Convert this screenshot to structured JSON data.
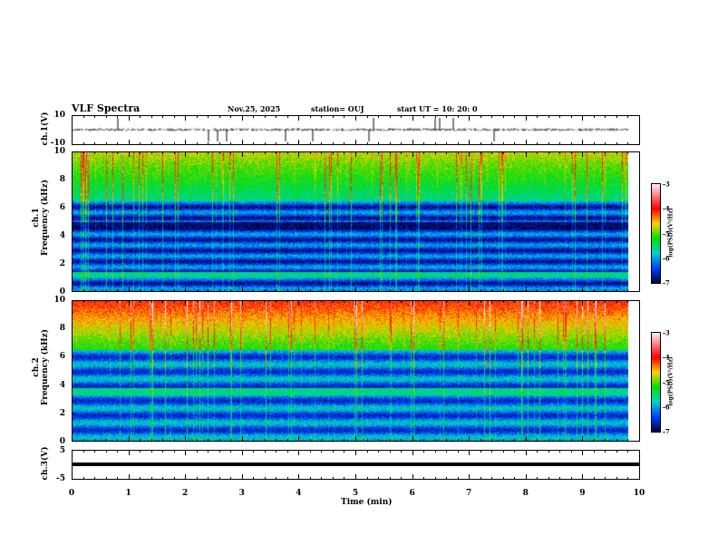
{
  "header": {
    "title": "VLF Spectra",
    "date": "Nov.25, 2025",
    "station": "station= OUJ",
    "start": "start  UT =   10: 20: 0"
  },
  "colors": {
    "frame": "#000000",
    "background": "#ffffff"
  },
  "chart_data": [
    {
      "type": "line",
      "ylabel": "ch.1(V)",
      "ylim": [
        -10,
        10
      ],
      "yticks": [
        "10",
        "-10"
      ],
      "xlim": [
        0,
        10
      ],
      "description_series": "waveform ~0 V with spikes"
    },
    {
      "type": "heatmap",
      "ylabel": "ch.1\nFrequency (kHz)",
      "ylabel_lines": [
        "ch.1",
        "Frequency (kHz)"
      ],
      "ylim": [
        0,
        10
      ],
      "yticks": [
        "0",
        "2",
        "4",
        "6",
        "8",
        "10"
      ],
      "xlim": [
        0,
        10
      ],
      "colorbar": {
        "label": "log(PSD)(V²/Hz)",
        "range": [
          -7,
          -3
        ],
        "ticks": [
          "-3",
          "-4",
          "-5",
          "-6",
          "-7"
        ]
      }
    },
    {
      "type": "heatmap",
      "ylabel_lines": [
        "ch.2",
        "Frequency (kHz)"
      ],
      "ylim": [
        0,
        10
      ],
      "yticks": [
        "0",
        "2",
        "4",
        "6",
        "8",
        "10"
      ],
      "xlim": [
        0,
        10
      ],
      "colorbar": {
        "label": "log(PSD)(V²/Hz)",
        "range": [
          -7,
          -3
        ],
        "ticks": [
          "-3",
          "-4",
          "-5",
          "-6",
          "-7"
        ]
      }
    },
    {
      "type": "line",
      "ylabel": "ch.3(V)",
      "ylim": [
        -5,
        5
      ],
      "yticks": [
        "5",
        "-5"
      ],
      "xlim": [
        0,
        10
      ],
      "constant_value": 0.2
    }
  ],
  "xaxis": {
    "label": "Time  (min)",
    "ticks": [
      "0",
      "1",
      "2",
      "3",
      "4",
      "5",
      "6",
      "7",
      "8",
      "9",
      "10"
    ]
  }
}
